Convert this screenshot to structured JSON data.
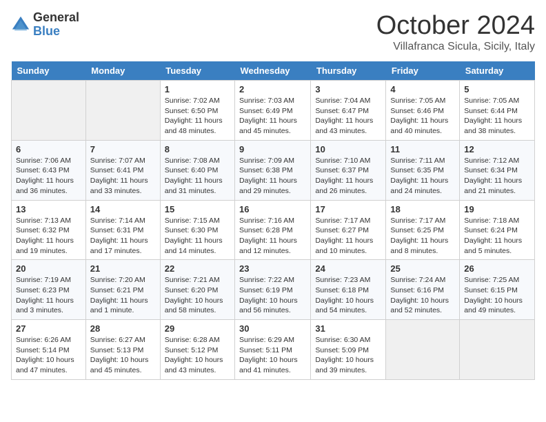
{
  "logo": {
    "general": "General",
    "blue": "Blue"
  },
  "title": "October 2024",
  "location": "Villafranca Sicula, Sicily, Italy",
  "headers": [
    "Sunday",
    "Monday",
    "Tuesday",
    "Wednesday",
    "Thursday",
    "Friday",
    "Saturday"
  ],
  "weeks": [
    [
      {
        "day": "",
        "info": ""
      },
      {
        "day": "",
        "info": ""
      },
      {
        "day": "1",
        "info": "Sunrise: 7:02 AM\nSunset: 6:50 PM\nDaylight: 11 hours and 48 minutes."
      },
      {
        "day": "2",
        "info": "Sunrise: 7:03 AM\nSunset: 6:49 PM\nDaylight: 11 hours and 45 minutes."
      },
      {
        "day": "3",
        "info": "Sunrise: 7:04 AM\nSunset: 6:47 PM\nDaylight: 11 hours and 43 minutes."
      },
      {
        "day": "4",
        "info": "Sunrise: 7:05 AM\nSunset: 6:46 PM\nDaylight: 11 hours and 40 minutes."
      },
      {
        "day": "5",
        "info": "Sunrise: 7:05 AM\nSunset: 6:44 PM\nDaylight: 11 hours and 38 minutes."
      }
    ],
    [
      {
        "day": "6",
        "info": "Sunrise: 7:06 AM\nSunset: 6:43 PM\nDaylight: 11 hours and 36 minutes."
      },
      {
        "day": "7",
        "info": "Sunrise: 7:07 AM\nSunset: 6:41 PM\nDaylight: 11 hours and 33 minutes."
      },
      {
        "day": "8",
        "info": "Sunrise: 7:08 AM\nSunset: 6:40 PM\nDaylight: 11 hours and 31 minutes."
      },
      {
        "day": "9",
        "info": "Sunrise: 7:09 AM\nSunset: 6:38 PM\nDaylight: 11 hours and 29 minutes."
      },
      {
        "day": "10",
        "info": "Sunrise: 7:10 AM\nSunset: 6:37 PM\nDaylight: 11 hours and 26 minutes."
      },
      {
        "day": "11",
        "info": "Sunrise: 7:11 AM\nSunset: 6:35 PM\nDaylight: 11 hours and 24 minutes."
      },
      {
        "day": "12",
        "info": "Sunrise: 7:12 AM\nSunset: 6:34 PM\nDaylight: 11 hours and 21 minutes."
      }
    ],
    [
      {
        "day": "13",
        "info": "Sunrise: 7:13 AM\nSunset: 6:32 PM\nDaylight: 11 hours and 19 minutes."
      },
      {
        "day": "14",
        "info": "Sunrise: 7:14 AM\nSunset: 6:31 PM\nDaylight: 11 hours and 17 minutes."
      },
      {
        "day": "15",
        "info": "Sunrise: 7:15 AM\nSunset: 6:30 PM\nDaylight: 11 hours and 14 minutes."
      },
      {
        "day": "16",
        "info": "Sunrise: 7:16 AM\nSunset: 6:28 PM\nDaylight: 11 hours and 12 minutes."
      },
      {
        "day": "17",
        "info": "Sunrise: 7:17 AM\nSunset: 6:27 PM\nDaylight: 11 hours and 10 minutes."
      },
      {
        "day": "18",
        "info": "Sunrise: 7:17 AM\nSunset: 6:25 PM\nDaylight: 11 hours and 8 minutes."
      },
      {
        "day": "19",
        "info": "Sunrise: 7:18 AM\nSunset: 6:24 PM\nDaylight: 11 hours and 5 minutes."
      }
    ],
    [
      {
        "day": "20",
        "info": "Sunrise: 7:19 AM\nSunset: 6:23 PM\nDaylight: 11 hours and 3 minutes."
      },
      {
        "day": "21",
        "info": "Sunrise: 7:20 AM\nSunset: 6:21 PM\nDaylight: 11 hours and 1 minute."
      },
      {
        "day": "22",
        "info": "Sunrise: 7:21 AM\nSunset: 6:20 PM\nDaylight: 10 hours and 58 minutes."
      },
      {
        "day": "23",
        "info": "Sunrise: 7:22 AM\nSunset: 6:19 PM\nDaylight: 10 hours and 56 minutes."
      },
      {
        "day": "24",
        "info": "Sunrise: 7:23 AM\nSunset: 6:18 PM\nDaylight: 10 hours and 54 minutes."
      },
      {
        "day": "25",
        "info": "Sunrise: 7:24 AM\nSunset: 6:16 PM\nDaylight: 10 hours and 52 minutes."
      },
      {
        "day": "26",
        "info": "Sunrise: 7:25 AM\nSunset: 6:15 PM\nDaylight: 10 hours and 49 minutes."
      }
    ],
    [
      {
        "day": "27",
        "info": "Sunrise: 6:26 AM\nSunset: 5:14 PM\nDaylight: 10 hours and 47 minutes."
      },
      {
        "day": "28",
        "info": "Sunrise: 6:27 AM\nSunset: 5:13 PM\nDaylight: 10 hours and 45 minutes."
      },
      {
        "day": "29",
        "info": "Sunrise: 6:28 AM\nSunset: 5:12 PM\nDaylight: 10 hours and 43 minutes."
      },
      {
        "day": "30",
        "info": "Sunrise: 6:29 AM\nSunset: 5:11 PM\nDaylight: 10 hours and 41 minutes."
      },
      {
        "day": "31",
        "info": "Sunrise: 6:30 AM\nSunset: 5:09 PM\nDaylight: 10 hours and 39 minutes."
      },
      {
        "day": "",
        "info": ""
      },
      {
        "day": "",
        "info": ""
      }
    ]
  ]
}
